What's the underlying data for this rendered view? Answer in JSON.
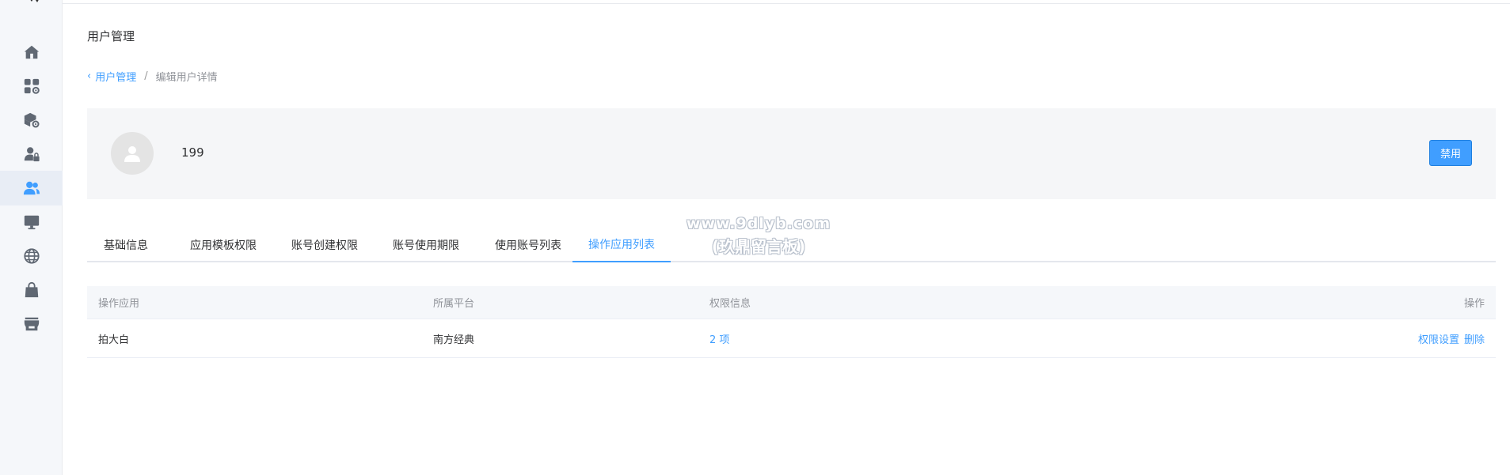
{
  "header": {
    "title": "用户管理"
  },
  "breadcrumb": {
    "back_label": "用户管理",
    "separator": "/",
    "current": "编辑用户详情"
  },
  "user": {
    "name": "199",
    "disable_button": "禁用"
  },
  "tabs": [
    {
      "label": "基础信息",
      "active": false
    },
    {
      "label": "应用模板权限",
      "active": false
    },
    {
      "label": "账号创建权限",
      "active": false
    },
    {
      "label": "账号使用期限",
      "active": false
    },
    {
      "label": "使用账号列表",
      "active": false
    },
    {
      "label": "操作应用列表",
      "active": true
    }
  ],
  "table": {
    "columns": [
      "操作应用",
      "所属平台",
      "权限信息",
      "操作"
    ],
    "rows": [
      {
        "app": "拍大白",
        "platform": "南方经典",
        "permissions": "2 项",
        "actions": [
          "权限设置",
          "删除"
        ]
      }
    ]
  },
  "sidebar": {
    "items": [
      {
        "icon": "home-icon",
        "active": false
      },
      {
        "icon": "apps-settings-icon",
        "active": false
      },
      {
        "icon": "package-settings-icon",
        "active": false
      },
      {
        "icon": "user-lock-icon",
        "active": false
      },
      {
        "icon": "users-icon",
        "active": true
      },
      {
        "icon": "monitor-icon",
        "active": false
      },
      {
        "icon": "globe-icon",
        "active": false
      },
      {
        "icon": "shopping-bag-icon",
        "active": false
      },
      {
        "icon": "store-icon",
        "active": false
      }
    ]
  },
  "watermark": {
    "line1": "www.9dlyb.com",
    "line2": "(玖鼎留言板)"
  },
  "colors": {
    "accent": "#409eff",
    "sidebar_bg": "#f5f7fa",
    "icon": "#606873",
    "icon_active": "#409eff"
  }
}
